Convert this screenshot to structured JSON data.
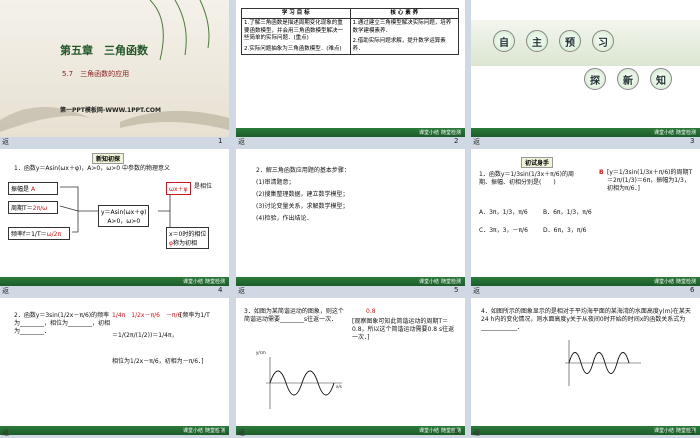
{
  "slides": {
    "s1": {
      "chapter": "第五章　三角函数",
      "section": "5.7　三角函数的应用",
      "watermark": "第一PPT模板网-WWW.1PPT.COM",
      "page": "1"
    },
    "s2": {
      "col1_header": "学 习 目 标",
      "col2_header": "核 心 素 养",
      "goal1": "1.了解三角函数是描述周期变化现象的重要函数模型，并会用三角函数模型解决一些简单的实际问题．(重点)",
      "goal2": "2.实际问题抽象为三角函数模型．(难点)",
      "core1": "1.通过建立三角模型解决实际问题，培养数学建模素养．",
      "core2": "2.借助实际问题求解，提升数学运算素养．",
      "page": "2"
    },
    "s3": {
      "chars_a": [
        "自",
        "主",
        "预",
        "习"
      ],
      "chars_b": [
        "探",
        "新",
        "知"
      ],
      "page": "3"
    },
    "s4": {
      "badge": "新知初探",
      "q1": "1．函数y＝Asin(ωx＋φ)，A>0，ω>0 中参数的物理意义",
      "amp": "振幅是",
      "amp_val": "A",
      "period": "周期T＝",
      "period_val": "2π/ω",
      "freq": "频率f＝1/T＝",
      "freq_val": "ω/2π",
      "center1": "y＝Asin(ωx＋φ)",
      "center2": "A>0，ω>0",
      "phase": "ωx＋φ",
      "phase_tail": "是相位",
      "init1": "x＝0时的相位",
      "init2": "φ",
      "init3": "称为初相",
      "page": "4"
    },
    "s5": {
      "q2": "2．解三角函数应用题的基本步骤：",
      "steps": [
        "(1)审清题意；",
        "(2)搜集整理数据，建立数学模型；",
        "(3)讨论变量关系，求解数学模型；",
        "(4)检验，作出结论．"
      ],
      "page": "5"
    },
    "s6": {
      "badge": "初试身手",
      "q": "1．函数y＝1/3sin(1/3x＋π/6)的周期、振幅、初相分别是(　　)",
      "optA": "A．3π，1/3，π/6",
      "optB": "B．6π，1/3，π/6",
      "optC": "C．3π，3，－π/6",
      "optD": "D．6π，3，π/6",
      "ans": "B",
      "sol": "[y＝1/3sin(1/3x＋π/6)的周期T＝2π/(1/3)＝6π，振幅为1/3，初相为π/6．]",
      "page": "6"
    },
    "s7": {
      "q": "2．函数y＝3sin(1/2x－π/6)的频率为________，相位为________，初相为________．",
      "ans": "1/4π　1/2x－π/6　－π/6",
      "sol1": "[频率为1/T",
      "sol2": "＝1/(2π/(1/2))＝1/4π，",
      "sol3": "相位为1/2x－π/6，初相为－π/6．]",
      "page": "7"
    },
    "s8": {
      "q": "3．如图为某简谐运动的图象，则这个简谐运动需要________s往返一次．",
      "ans": "0.8",
      "sol": "[观察图象可知此简谐运动的周期T＝0.8，所以这个简谐运动需要0.8 s往返一次．]",
      "ylabel": "y/cm",
      "xlabel": "x/s",
      "page": "8"
    },
    "s9": {
      "q": "4．如图所示的图象显示的是相对于平均海平面的某海湾的水面高度y(m)在某天24 h内的变化情况，则水面高度y关于从夜间0时开始的时间x的函数关系式为____________．",
      "page": "9"
    }
  },
  "footer": {
    "left_label": "返",
    "mark1": "课堂小结",
    "mark2": "随堂检测"
  },
  "colors": {
    "accent_red": "#d0161c",
    "footer_green": "#2b7a3a",
    "grid_bg": "#cfd8e3"
  }
}
